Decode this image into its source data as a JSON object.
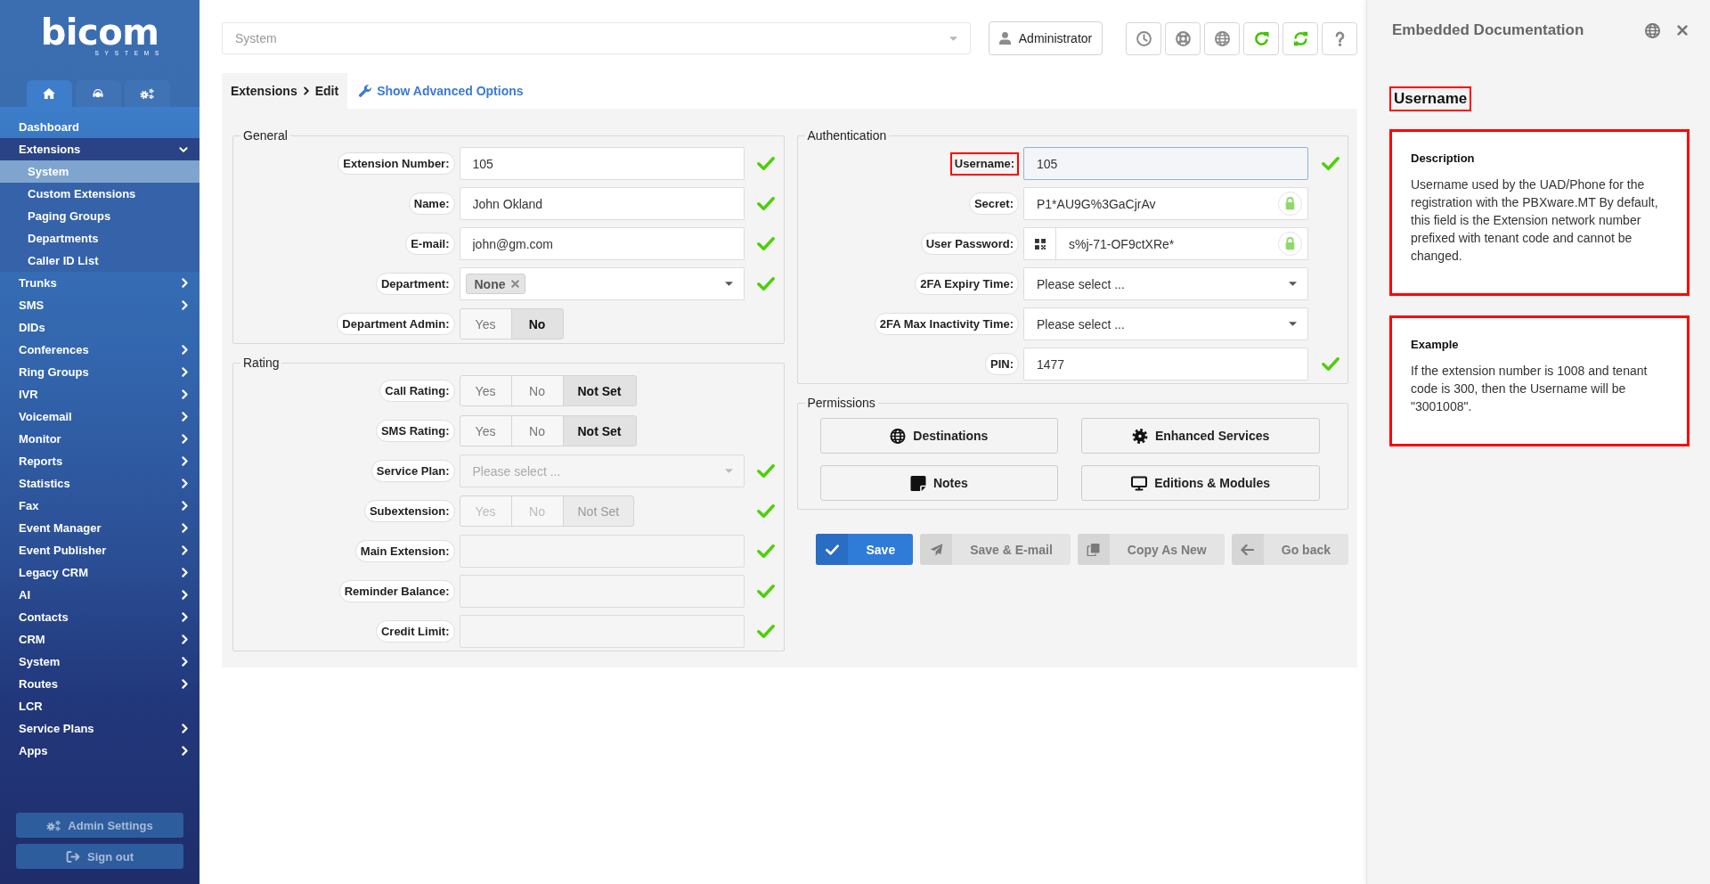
{
  "sidebar": {
    "logo": {
      "name": "bicom",
      "tagline": "SYSTEMS"
    },
    "tabs": [
      {
        "kind": "home",
        "selected": true
      },
      {
        "kind": "support",
        "selected": false
      },
      {
        "kind": "settings",
        "selected": false
      }
    ],
    "menu": [
      {
        "label": "Dashboard",
        "kind": "link",
        "expanded": false
      },
      {
        "label": "Extensions",
        "kind": "group",
        "expanded": true,
        "children": [
          {
            "label": "System",
            "selected": true
          },
          {
            "label": "Custom Extensions",
            "selected": false
          },
          {
            "label": "Paging Groups",
            "selected": false
          },
          {
            "label": "Departments",
            "selected": false
          },
          {
            "label": "Caller ID List",
            "selected": false
          }
        ]
      },
      {
        "label": "Trunks",
        "kind": "group",
        "expanded": false
      },
      {
        "label": "SMS",
        "kind": "group",
        "expanded": false
      },
      {
        "label": "DIDs",
        "kind": "link",
        "expanded": false
      },
      {
        "label": "Conferences",
        "kind": "group",
        "expanded": false
      },
      {
        "label": "Ring Groups",
        "kind": "group",
        "expanded": false
      },
      {
        "label": "IVR",
        "kind": "group",
        "expanded": false
      },
      {
        "label": "Voicemail",
        "kind": "group",
        "expanded": false
      },
      {
        "label": "Monitor",
        "kind": "group",
        "expanded": false
      },
      {
        "label": "Reports",
        "kind": "group",
        "expanded": false
      },
      {
        "label": "Statistics",
        "kind": "group",
        "expanded": false
      },
      {
        "label": "Fax",
        "kind": "group",
        "expanded": false
      },
      {
        "label": "Event Manager",
        "kind": "group",
        "expanded": false
      },
      {
        "label": "Event Publisher",
        "kind": "group",
        "expanded": false
      },
      {
        "label": "Legacy CRM",
        "kind": "group",
        "expanded": false
      },
      {
        "label": "AI",
        "kind": "group",
        "expanded": false
      },
      {
        "label": "Contacts",
        "kind": "group",
        "expanded": false
      },
      {
        "label": "CRM",
        "kind": "group",
        "expanded": false
      },
      {
        "label": "System",
        "kind": "group",
        "expanded": false
      },
      {
        "label": "Routes",
        "kind": "group",
        "expanded": false
      },
      {
        "label": "LCR",
        "kind": "link",
        "expanded": false
      },
      {
        "label": "Service Plans",
        "kind": "group",
        "expanded": false
      },
      {
        "label": "Apps",
        "kind": "group",
        "expanded": false
      }
    ],
    "footer": [
      {
        "label": "Admin Settings",
        "kind": "settings"
      },
      {
        "label": "Sign out",
        "kind": "signout"
      }
    ]
  },
  "topbar": {
    "context": {
      "placeholder": "System"
    },
    "user": {
      "label": "Administrator"
    },
    "tools": [
      {
        "kind": "clock"
      },
      {
        "kind": "support"
      },
      {
        "kind": "globe"
      },
      {
        "kind": "reload"
      },
      {
        "kind": "sync"
      },
      {
        "kind": "help"
      }
    ]
  },
  "breadcrumb": [
    "Extensions",
    "Edit"
  ],
  "advanced_link": "Show Advanced Options",
  "general": {
    "title": "General",
    "fields": [
      {
        "label": "Extension Number:",
        "kind": "text",
        "value": "105",
        "valid": true,
        "disabled": false,
        "focused": false,
        "highlighted": false
      },
      {
        "label": "Name:",
        "kind": "text",
        "value": "John Okland",
        "valid": true,
        "disabled": false,
        "focused": false,
        "highlighted": false
      },
      {
        "label": "E-mail:",
        "kind": "text",
        "value": "john@gm.com",
        "valid": true,
        "disabled": false,
        "focused": false,
        "highlighted": false
      },
      {
        "label": "Department:",
        "kind": "tags",
        "tags": [
          "None"
        ],
        "valid": true,
        "disabled": false,
        "focused": false,
        "highlighted": false
      },
      {
        "label": "Department Admin:",
        "kind": "toggle",
        "options": [
          {
            "label": "Yes",
            "selected": false
          },
          {
            "label": "No",
            "selected": true
          }
        ],
        "valid": false,
        "disabled": false,
        "focused": false,
        "highlighted": false
      }
    ]
  },
  "rating": {
    "title": "Rating",
    "fields": [
      {
        "label": "Call Rating:",
        "kind": "toggle",
        "options": [
          {
            "label": "Yes",
            "selected": false
          },
          {
            "label": "No",
            "selected": false
          },
          {
            "label": "Not Set",
            "selected": true
          }
        ],
        "valid": false,
        "disabled": false,
        "focused": false,
        "highlighted": false
      },
      {
        "label": "SMS Rating:",
        "kind": "toggle",
        "options": [
          {
            "label": "Yes",
            "selected": false
          },
          {
            "label": "No",
            "selected": false
          },
          {
            "label": "Not Set",
            "selected": true
          }
        ],
        "valid": false,
        "disabled": false,
        "focused": false,
        "highlighted": false
      },
      {
        "label": "Service Plan:",
        "kind": "select",
        "placeholder": "Please select ...",
        "valid": true,
        "disabled": true,
        "focused": false,
        "highlighted": false
      },
      {
        "label": "Subextension:",
        "kind": "toggle",
        "options": [
          {
            "label": "Yes",
            "selected": false
          },
          {
            "label": "No",
            "selected": false
          },
          {
            "label": "Not Set",
            "selected": true
          }
        ],
        "valid": true,
        "disabled": true,
        "focused": false,
        "highlighted": false
      },
      {
        "label": "Main Extension:",
        "kind": "text",
        "valid": true,
        "disabled": true,
        "focused": false,
        "highlighted": false
      },
      {
        "label": "Reminder Balance:",
        "kind": "text",
        "valid": true,
        "disabled": true,
        "focused": false,
        "highlighted": false
      },
      {
        "label": "Credit Limit:",
        "kind": "text",
        "valid": true,
        "disabled": true,
        "focused": false,
        "highlighted": false
      }
    ]
  },
  "authentication": {
    "title": "Authentication",
    "fields": [
      {
        "label": "Username:",
        "kind": "text",
        "value": "105",
        "valid": true,
        "disabled": false,
        "focused": true,
        "highlighted": true
      },
      {
        "label": "Secret:",
        "kind": "secret",
        "value": "P1*AU9G%3GaCjrAv",
        "valid": false,
        "disabled": false,
        "focused": false,
        "highlighted": false
      },
      {
        "label": "User Password:",
        "kind": "password",
        "value": "s%j-71-OF9ctXRe*",
        "valid": false,
        "disabled": false,
        "focused": false,
        "highlighted": false
      },
      {
        "label": "2FA Expiry Time:",
        "kind": "select",
        "placeholder": "Please select ...",
        "valid": false,
        "disabled": false,
        "focused": false,
        "highlighted": false
      },
      {
        "label": "2FA Max Inactivity Time:",
        "kind": "select",
        "placeholder": "Please select ...",
        "valid": false,
        "disabled": false,
        "focused": false,
        "highlighted": false
      },
      {
        "label": "PIN:",
        "kind": "text",
        "value": "1477",
        "valid": true,
        "disabled": false,
        "focused": false,
        "highlighted": false
      }
    ]
  },
  "permissions": {
    "title": "Permissions",
    "buttons": [
      {
        "label": "Destinations",
        "kind": "globe"
      },
      {
        "label": "Enhanced Services",
        "kind": "gear"
      },
      {
        "label": "Notes",
        "kind": "note"
      },
      {
        "label": "Editions & Modules",
        "kind": "monitor"
      }
    ]
  },
  "actions": [
    {
      "label": "Save",
      "kind": "save",
      "primary": true
    },
    {
      "label": "Save & E-mail",
      "kind": "email",
      "primary": false
    },
    {
      "label": "Copy As New",
      "kind": "copy",
      "primary": false
    },
    {
      "label": "Go back",
      "kind": "back",
      "primary": false
    }
  ],
  "documentation": {
    "title": "Embedded Documentation",
    "heading": {
      "text": "Username",
      "highlighted": true
    },
    "cards": [
      {
        "title": "Description",
        "text": "Username used by the UAD/Phone for the registration with the PBXware.MT By default, this field is the Extension network number prefixed with tenant code and cannot be changed.",
        "highlighted": true
      },
      {
        "title": "Example",
        "text": "If the extension number is 1008 and tenant code is 300, then the Username will be \"3001008\".",
        "highlighted": true
      }
    ]
  }
}
